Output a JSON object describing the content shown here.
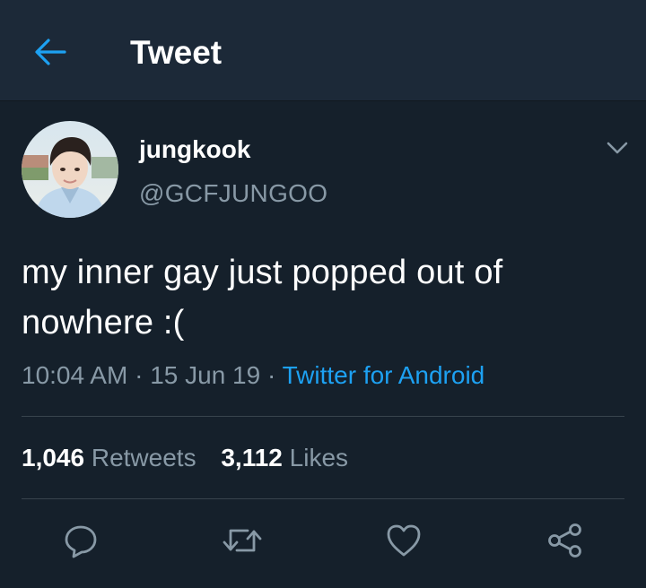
{
  "header": {
    "title": "Tweet",
    "back_icon": "arrow-left-icon"
  },
  "tweet": {
    "display_name": "jungkook",
    "handle": "@GCFJUNGOO",
    "text": "my inner gay just popped out of nowhere :(",
    "time": "10:04 AM",
    "date": "15 Jun 19",
    "separator": "·",
    "source": "Twitter for Android"
  },
  "stats": {
    "retweets_count": "1,046",
    "retweets_label": "Retweets",
    "likes_count": "3,112",
    "likes_label": "Likes"
  },
  "actions": [
    {
      "icon": "reply-icon"
    },
    {
      "icon": "retweet-icon"
    },
    {
      "icon": "like-heart-icon"
    },
    {
      "icon": "share-icon"
    }
  ],
  "colors": {
    "background": "#15202b",
    "header_background": "#1c2938",
    "accent": "#1da1f2",
    "secondary_text": "#8899a6",
    "divider": "#38444d"
  }
}
